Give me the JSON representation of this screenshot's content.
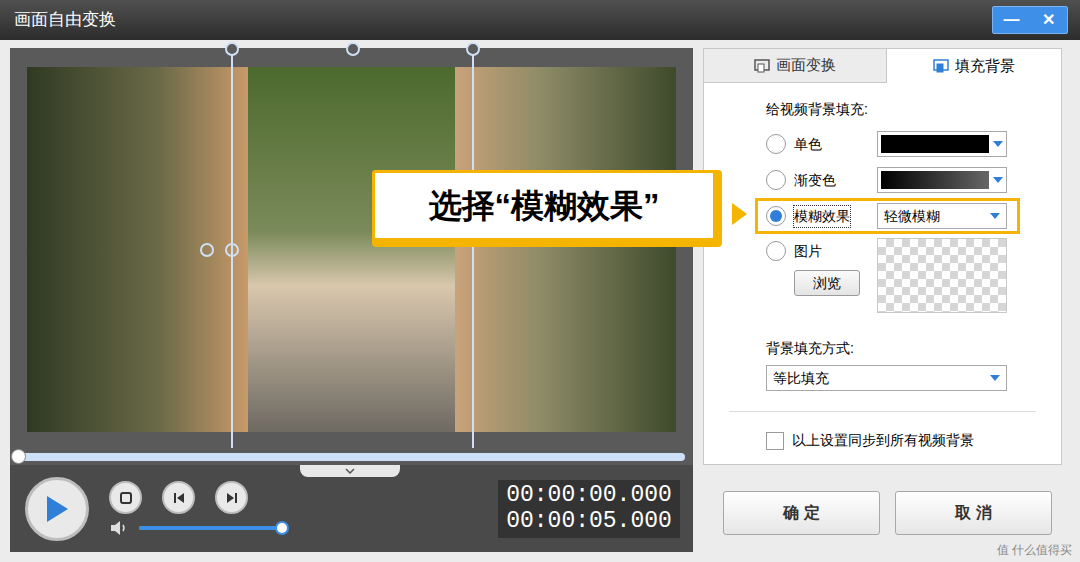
{
  "window": {
    "title": "画面自由变换",
    "controls": [
      "—",
      "✕"
    ]
  },
  "preview": {
    "progress": {
      "level": 0
    },
    "volume": {
      "level": 1
    },
    "times": {
      "current": "00:00:00.000",
      "total": "00:00:05.000"
    }
  },
  "tabs": [
    {
      "label": "画面变换",
      "selected": false
    },
    {
      "label": "填充背景",
      "selected": true
    }
  ],
  "fill": {
    "heading": "给视频背景填充:",
    "options": [
      {
        "label": "单色",
        "kind": "color",
        "selected": false,
        "highlighted": false
      },
      {
        "label": "渐变色",
        "kind": "gradient",
        "selected": false,
        "highlighted": false
      },
      {
        "label": "模糊效果",
        "kind": "select",
        "value": "轻微模糊",
        "selected": true,
        "highlighted": true
      },
      {
        "label": "图片",
        "kind": "image",
        "button": "浏览",
        "selected": false,
        "highlighted": false
      }
    ]
  },
  "mode": {
    "heading": "背景填充方式:",
    "value": "等比填充"
  },
  "sync": {
    "label": "以上设置同步到所有视频背景",
    "checked": false
  },
  "buttons": [
    "确 定",
    "取 消"
  ],
  "callout": {
    "text": "选择“模糊效果”"
  },
  "watermark": "值 什么值得买"
}
